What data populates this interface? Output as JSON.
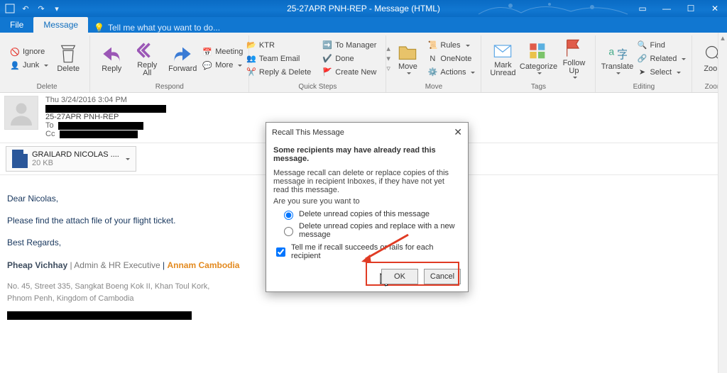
{
  "window": {
    "title": "25-27APR PNH-REP - Message (HTML)"
  },
  "tabs": {
    "file": "File",
    "message": "Message",
    "tellme": "Tell me what you want to do..."
  },
  "ribbon": {
    "ignore": "Ignore",
    "junk": "Junk",
    "delete": "Delete",
    "delete_grp": "Delete",
    "reply": "Reply",
    "replyall": "Reply\nAll",
    "forward": "Forward",
    "meeting": "Meeting",
    "more": "More",
    "respond_grp": "Respond",
    "qs": {
      "ktr": "KTR",
      "team": "Team Email",
      "replydel": "Reply & Delete",
      "tomgr": "To Manager",
      "done": "Done",
      "createnew": "Create New",
      "grp": "Quick Steps"
    },
    "move": "Move",
    "rules": "Rules",
    "onenote": "OneNote",
    "actions": "Actions",
    "move_grp": "Move",
    "markunread": "Mark\nUnread",
    "categorize": "Categorize",
    "followup": "Follow\nUp",
    "tags_grp": "Tags",
    "translate": "Translate",
    "find": "Find",
    "related": "Related",
    "select": "Select",
    "editing_grp": "Editing",
    "zoom": "Zoom",
    "zoom_grp": "Zoom"
  },
  "header": {
    "date": "Thu 3/24/2016 3:04 PM",
    "subject": "25-27APR PNH-REP",
    "to": "To",
    "cc": "Cc"
  },
  "attachment": {
    "name": "GRAILARD NICOLAS ....",
    "size": "20 KB"
  },
  "bodytxt": {
    "greet": "Dear Nicolas,",
    "line": "Please find the attach file of your flight ticket.",
    "regards": "Best Regards,",
    "sig_name": "Pheap Vichhay",
    "sig_sep": " | ",
    "sig_title": "Admin & HR Executive",
    "sig_co": "Annam Cambodia",
    "addr1": "No. 45, Street 335, Sangkat Boeng Kok II, Khan Toul Kork,",
    "addr2": "Phnom Penh, Kingdom of Cambodia"
  },
  "dialog": {
    "title": "Recall This Message",
    "lead": "Some recipients may have already read this message.",
    "p1": "Message recall can delete or replace copies of this message in recipient Inboxes, if they have not yet read this message.",
    "p2": "Are you sure you want to",
    "opt1": "Delete unread copies of this message",
    "opt2": "Delete unread copies and replace with a new message",
    "chk": "Tell me if recall succeeds or fails for each recipient",
    "ok": "OK",
    "cancel": "Cancel"
  }
}
